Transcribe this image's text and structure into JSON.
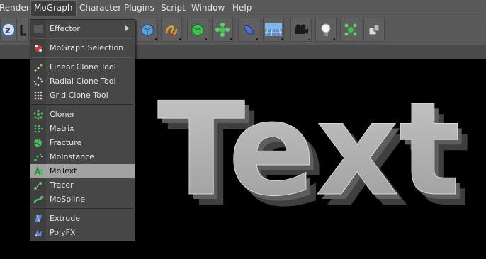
{
  "menubar": {
    "items": [
      "Render",
      "MoGraph",
      "Character",
      "Plugins",
      "Script",
      "Window",
      "Help"
    ]
  },
  "toolbar": {
    "icons": [
      "undo-z-icon",
      "move-icon",
      "cube-icon",
      "spline-icon",
      "nurbs-icon",
      "array-icon",
      "deformer-icon",
      "floor-icon",
      "camera-icon",
      "light-icon",
      "mograph-icon",
      "tag-icon"
    ]
  },
  "menu": {
    "items": [
      {
        "label": "Effector",
        "icon": "effector-icon"
      },
      {
        "label": "MoGraph Selection",
        "icon": "mograph-selection-icon"
      },
      {
        "label": "Linear Clone Tool",
        "icon": "linear-clone-icon"
      },
      {
        "label": "Radial Clone Tool",
        "icon": "radial-clone-icon"
      },
      {
        "label": "Grid Clone Tool",
        "icon": "grid-clone-icon"
      },
      {
        "label": "Cloner",
        "icon": "cloner-icon"
      },
      {
        "label": "Matrix",
        "icon": "matrix-icon"
      },
      {
        "label": "Fracture",
        "icon": "fracture-icon"
      },
      {
        "label": "MoInstance",
        "icon": "moinstance-icon"
      },
      {
        "label": "MoText",
        "icon": "motext-icon"
      },
      {
        "label": "Tracer",
        "icon": "tracer-icon"
      },
      {
        "label": "MoSpline",
        "icon": "mospline-icon"
      },
      {
        "label": "Extrude",
        "icon": "extrude-icon"
      },
      {
        "label": "PolyFX",
        "icon": "polyfx-icon"
      }
    ]
  },
  "viewport": {
    "text3d": "Text"
  },
  "colors": {
    "menu_bg": "#474747",
    "highlight": "#a2a2a2",
    "toolbar": "#595959"
  }
}
